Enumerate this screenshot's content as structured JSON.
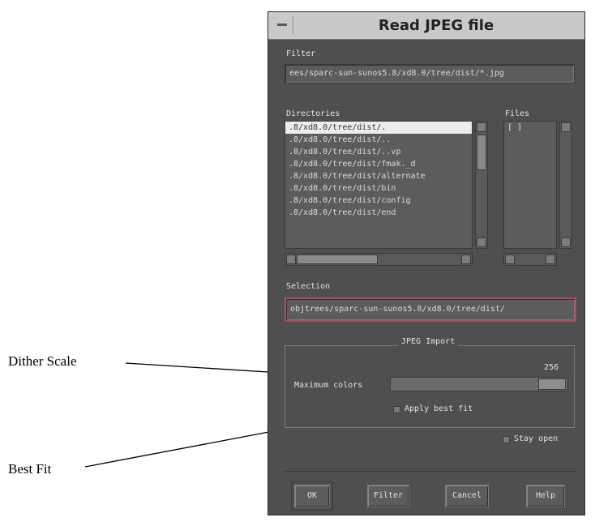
{
  "callouts": {
    "dither_scale": "Dither Scale",
    "best_fit": "Best Fit"
  },
  "dialog": {
    "title": "Read JPEG file",
    "filter_label": "Filter",
    "filter_value": "ees/sparc-sun-sunos5.8/xd8.0/tree/dist/*.jpg",
    "directories_label": "Directories",
    "files_label": "Files",
    "directories": [
      ".8/xd8.0/tree/dist/.",
      ".8/xd8.0/tree/dist/..",
      ".8/xd8.0/tree/dist/..vp",
      ".8/xd8.0/tree/dist/fmak._d",
      ".8/xd8.0/tree/dist/alternate",
      ".8/xd8.0/tree/dist/bin",
      ".8/xd8.0/tree/dist/config",
      ".8/xd8.0/tree/dist/end"
    ],
    "files": [
      "[   ]"
    ],
    "selection_label": "Selection",
    "selection_value": "objtrees/sparc-sun-sunos5.8/xd8.0/tree/dist/",
    "jpeg_import": {
      "group_title": "JPEG Import",
      "max_colors_label": "Maximum colors",
      "max_colors_value": "256",
      "apply_best_fit": "Apply best fit"
    },
    "stay_open": "Stay open",
    "buttons": {
      "ok": "OK",
      "filter": "Filter",
      "cancel": "Cancel",
      "help": "Help"
    }
  },
  "colors": {
    "panel": "#4f4f4f",
    "title_bar": "#c9c9c9",
    "selection_border": "#b04a5c"
  },
  "icons": [
    "window-menu-icon",
    "scroll-up-arrow-icon",
    "scroll-down-arrow-icon",
    "scroll-left-arrow-icon",
    "scroll-right-arrow-icon"
  ]
}
